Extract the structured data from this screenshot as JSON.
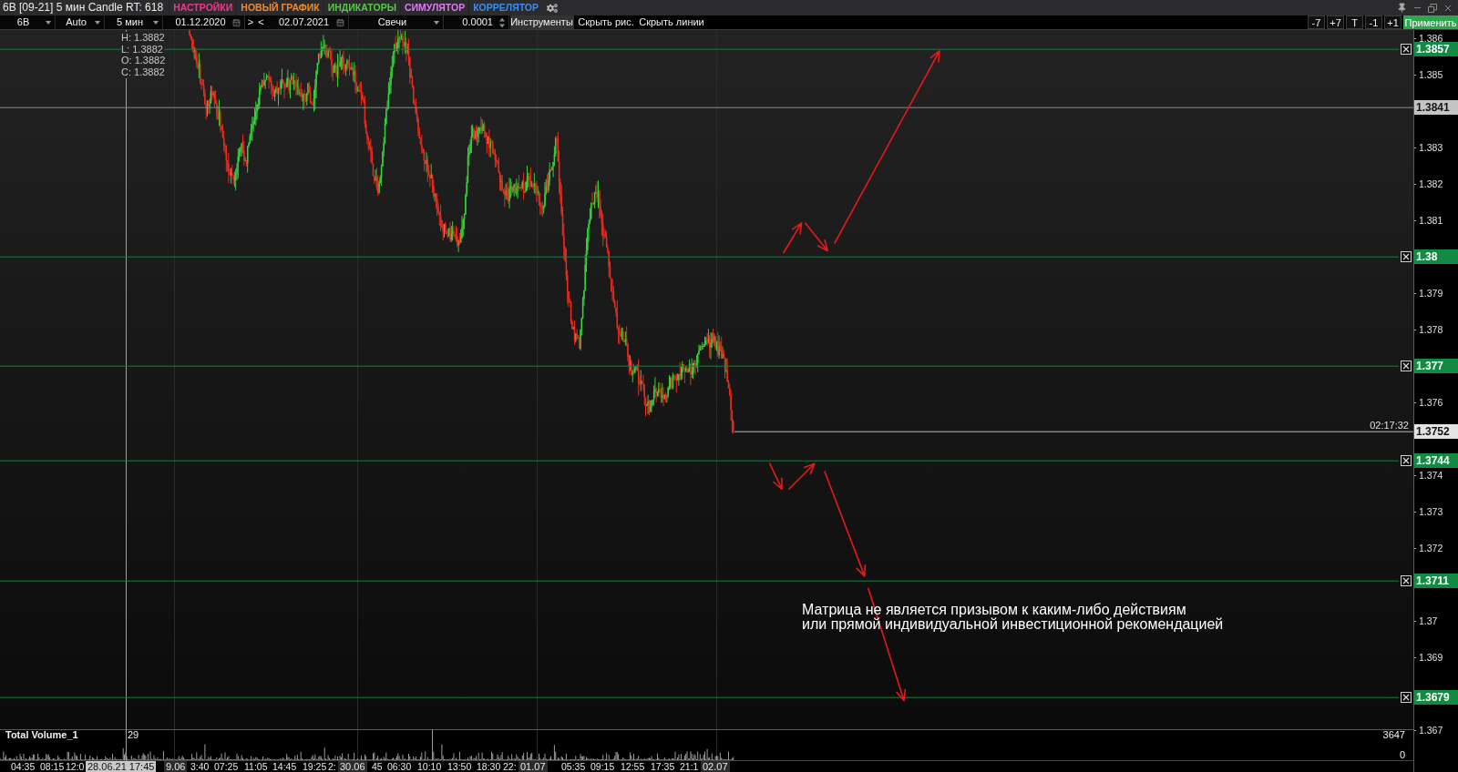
{
  "window": {
    "title": "6B [09-21] 5 мин Candle RT: 618",
    "menu": [
      {
        "label": "НАСТРОЙКИ",
        "color": "#f0388f"
      },
      {
        "label": "НОВЫЙ ГРАФИК",
        "color": "#f28a2e"
      },
      {
        "label": "ИНДИКАТОРЫ",
        "color": "#55cc44"
      },
      {
        "label": "СИМУЛЯТОР",
        "color": "#dc7cf0"
      },
      {
        "label": "КОРРЕЛЯТОР",
        "color": "#3d8ef0"
      }
    ]
  },
  "toolbar": {
    "fields": [
      {
        "kind": "dropdown",
        "value": "6B"
      },
      {
        "kind": "dropdown",
        "value": "Auto"
      },
      {
        "kind": "dropdown",
        "value": "5 мин"
      },
      {
        "kind": "date",
        "value": "01.12.2020"
      },
      {
        "kind": "step",
        "value": ">"
      },
      {
        "kind": "step",
        "value": "<"
      },
      {
        "kind": "date",
        "value": "02.07.2021"
      },
      {
        "kind": "dropdown",
        "value": "Свечи"
      },
      {
        "kind": "spinner",
        "value": "0.0001"
      },
      {
        "kind": "button",
        "value": "Инструменты"
      },
      {
        "kind": "link",
        "value": "Скрыть рис."
      },
      {
        "kind": "link",
        "value": "Скрыть линии"
      }
    ],
    "shift_buttons": [
      "-7",
      "+7",
      "T",
      "-1",
      "+1"
    ],
    "apply": "Применить"
  },
  "chart": {
    "ohlc": [
      "H: 1.3882",
      "L: 1.3882",
      "O: 1.3882",
      "C: 1.3882"
    ],
    "price_ticks": [
      "1.386",
      "1.385",
      "1.383",
      "1.382",
      "1.381",
      "1.379",
      "1.378",
      "1.376",
      "1.374",
      "1.373",
      "1.372",
      "1.37",
      "1.369",
      "1.367"
    ],
    "levels": [
      {
        "label": "1.3857",
        "kind": "alert"
      },
      {
        "label": "1.3841",
        "kind": "marker"
      },
      {
        "label": "1.38",
        "kind": "alert"
      },
      {
        "label": "1.377",
        "kind": "alert"
      },
      {
        "label": "1.3752",
        "kind": "last",
        "time": "02:17:32"
      },
      {
        "label": "1.3744",
        "kind": "alert"
      },
      {
        "label": "1.3711",
        "kind": "alert"
      },
      {
        "label": "1.3679",
        "kind": "alert"
      }
    ],
    "note": "Матрица не является призывом к каким-либо действиям\nили прямой индивидуальной инвестиционной рекомендацией",
    "volume": {
      "title": "Total Volume_1",
      "cursor_value": "29",
      "max": "3647",
      "min": "0"
    },
    "time_axis": [
      {
        "label": "04:35",
        "kind": "time"
      },
      {
        "label": "08:15",
        "kind": "time"
      },
      {
        "label": "12:0",
        "kind": "time"
      },
      {
        "label": "28.06.21 17:45",
        "kind": "cursor"
      },
      {
        "label": "9.06",
        "kind": "date"
      },
      {
        "label": "3:40",
        "kind": "time"
      },
      {
        "label": "07:25",
        "kind": "time"
      },
      {
        "label": "11:05",
        "kind": "time"
      },
      {
        "label": "14:45",
        "kind": "time"
      },
      {
        "label": "19:25",
        "kind": "time"
      },
      {
        "label": "2:",
        "kind": "time"
      },
      {
        "label": "30.06",
        "kind": "date"
      },
      {
        "label": "45",
        "kind": "time"
      },
      {
        "label": "06:30",
        "kind": "time"
      },
      {
        "label": "10:10",
        "kind": "time"
      },
      {
        "label": "13:50",
        "kind": "time"
      },
      {
        "label": "18:30",
        "kind": "time"
      },
      {
        "label": "22:",
        "kind": "time"
      },
      {
        "label": "01.07",
        "kind": "date"
      },
      {
        "label": "05:35",
        "kind": "time"
      },
      {
        "label": "09:15",
        "kind": "time"
      },
      {
        "label": "12:55",
        "kind": "time"
      },
      {
        "label": "17:35",
        "kind": "time"
      },
      {
        "label": "21:1",
        "kind": "time"
      },
      {
        "label": "02.07",
        "kind": "date"
      }
    ]
  }
}
